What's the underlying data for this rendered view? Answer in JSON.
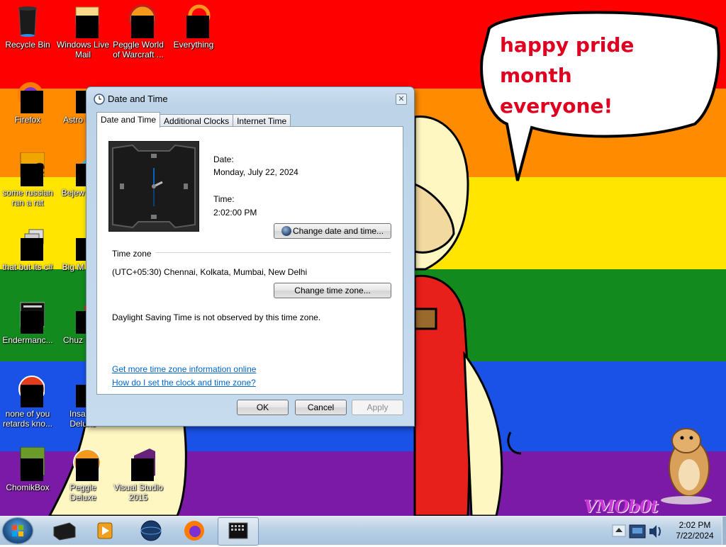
{
  "desktop": {
    "icons": [
      {
        "label": "Recycle Bin"
      },
      {
        "label": "Windows Live Mail"
      },
      {
        "label": "Peggle World of Warcraft ..."
      },
      {
        "label": "Everything"
      },
      {
        "label": "Firefox"
      },
      {
        "label": "Astro Delu"
      },
      {
        "label": "some russian ran a rat"
      },
      {
        "label": "Bejew Delu"
      },
      {
        "label": "that but its c#"
      },
      {
        "label": "Big M Delu"
      },
      {
        "label": "Endermanc..."
      },
      {
        "label": "Chuz Delu"
      },
      {
        "label": "none of you retards kno..."
      },
      {
        "label": "Insanic Deluxe"
      },
      {
        "label": "ChomikBox"
      },
      {
        "label": "Peggle Deluxe"
      },
      {
        "label": "Visual Studio 2015"
      }
    ],
    "speech_line1": "happy pride month",
    "speech_line2": "everyone!",
    "watermark": "VMOb0t"
  },
  "dialog": {
    "title": "Date and Time",
    "close_glyph": "✕",
    "tabs": [
      {
        "label": "Date and Time",
        "active": true
      },
      {
        "label": "Additional Clocks",
        "active": false
      },
      {
        "label": "Internet Time",
        "active": false
      }
    ],
    "date_label": "Date:",
    "date_value": "Monday, July 22, 2024",
    "time_label": "Time:",
    "time_value": "2:02:00 PM",
    "change_datetime_button": "Change date and time...",
    "timezone_heading": "Time zone",
    "timezone_value": "(UTC+05:30) Chennai, Kolkata, Mumbai, New Delhi",
    "change_timezone_button": "Change time zone...",
    "dst_note": "Daylight Saving Time is not observed by this time zone.",
    "link_more_info": "Get more time zone information online",
    "link_how_to": "How do I set the clock and time zone?",
    "ok_button": "OK",
    "cancel_button": "Cancel",
    "apply_button": "Apply"
  },
  "taskbar": {
    "apps": [
      "app-black-box",
      "media-player",
      "app-globe",
      "firefox",
      "date-time-control-panel"
    ],
    "clock_time": "2:02 PM",
    "clock_date": "7/22/2024"
  },
  "colors": {
    "rainbow": [
      "#ff0000",
      "#ff8c00",
      "#ffe500",
      "#138a1e",
      "#1a52e8",
      "#7b1aa6"
    ],
    "link": "#0066cc",
    "speech_text": "#e00020"
  }
}
